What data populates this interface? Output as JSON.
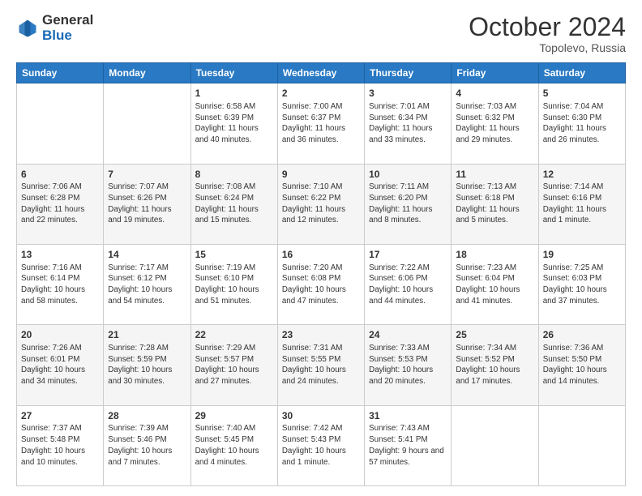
{
  "header": {
    "logo_general": "General",
    "logo_blue": "Blue",
    "month_title": "October 2024",
    "location": "Topolevo, Russia"
  },
  "days_of_week": [
    "Sunday",
    "Monday",
    "Tuesday",
    "Wednesday",
    "Thursday",
    "Friday",
    "Saturday"
  ],
  "weeks": [
    [
      {
        "day": "",
        "sunrise": "",
        "sunset": "",
        "daylight": ""
      },
      {
        "day": "",
        "sunrise": "",
        "sunset": "",
        "daylight": ""
      },
      {
        "day": "1",
        "sunrise": "Sunrise: 6:58 AM",
        "sunset": "Sunset: 6:39 PM",
        "daylight": "Daylight: 11 hours and 40 minutes."
      },
      {
        "day": "2",
        "sunrise": "Sunrise: 7:00 AM",
        "sunset": "Sunset: 6:37 PM",
        "daylight": "Daylight: 11 hours and 36 minutes."
      },
      {
        "day": "3",
        "sunrise": "Sunrise: 7:01 AM",
        "sunset": "Sunset: 6:34 PM",
        "daylight": "Daylight: 11 hours and 33 minutes."
      },
      {
        "day": "4",
        "sunrise": "Sunrise: 7:03 AM",
        "sunset": "Sunset: 6:32 PM",
        "daylight": "Daylight: 11 hours and 29 minutes."
      },
      {
        "day": "5",
        "sunrise": "Sunrise: 7:04 AM",
        "sunset": "Sunset: 6:30 PM",
        "daylight": "Daylight: 11 hours and 26 minutes."
      }
    ],
    [
      {
        "day": "6",
        "sunrise": "Sunrise: 7:06 AM",
        "sunset": "Sunset: 6:28 PM",
        "daylight": "Daylight: 11 hours and 22 minutes."
      },
      {
        "day": "7",
        "sunrise": "Sunrise: 7:07 AM",
        "sunset": "Sunset: 6:26 PM",
        "daylight": "Daylight: 11 hours and 19 minutes."
      },
      {
        "day": "8",
        "sunrise": "Sunrise: 7:08 AM",
        "sunset": "Sunset: 6:24 PM",
        "daylight": "Daylight: 11 hours and 15 minutes."
      },
      {
        "day": "9",
        "sunrise": "Sunrise: 7:10 AM",
        "sunset": "Sunset: 6:22 PM",
        "daylight": "Daylight: 11 hours and 12 minutes."
      },
      {
        "day": "10",
        "sunrise": "Sunrise: 7:11 AM",
        "sunset": "Sunset: 6:20 PM",
        "daylight": "Daylight: 11 hours and 8 minutes."
      },
      {
        "day": "11",
        "sunrise": "Sunrise: 7:13 AM",
        "sunset": "Sunset: 6:18 PM",
        "daylight": "Daylight: 11 hours and 5 minutes."
      },
      {
        "day": "12",
        "sunrise": "Sunrise: 7:14 AM",
        "sunset": "Sunset: 6:16 PM",
        "daylight": "Daylight: 11 hours and 1 minute."
      }
    ],
    [
      {
        "day": "13",
        "sunrise": "Sunrise: 7:16 AM",
        "sunset": "Sunset: 6:14 PM",
        "daylight": "Daylight: 10 hours and 58 minutes."
      },
      {
        "day": "14",
        "sunrise": "Sunrise: 7:17 AM",
        "sunset": "Sunset: 6:12 PM",
        "daylight": "Daylight: 10 hours and 54 minutes."
      },
      {
        "day": "15",
        "sunrise": "Sunrise: 7:19 AM",
        "sunset": "Sunset: 6:10 PM",
        "daylight": "Daylight: 10 hours and 51 minutes."
      },
      {
        "day": "16",
        "sunrise": "Sunrise: 7:20 AM",
        "sunset": "Sunset: 6:08 PM",
        "daylight": "Daylight: 10 hours and 47 minutes."
      },
      {
        "day": "17",
        "sunrise": "Sunrise: 7:22 AM",
        "sunset": "Sunset: 6:06 PM",
        "daylight": "Daylight: 10 hours and 44 minutes."
      },
      {
        "day": "18",
        "sunrise": "Sunrise: 7:23 AM",
        "sunset": "Sunset: 6:04 PM",
        "daylight": "Daylight: 10 hours and 41 minutes."
      },
      {
        "day": "19",
        "sunrise": "Sunrise: 7:25 AM",
        "sunset": "Sunset: 6:03 PM",
        "daylight": "Daylight: 10 hours and 37 minutes."
      }
    ],
    [
      {
        "day": "20",
        "sunrise": "Sunrise: 7:26 AM",
        "sunset": "Sunset: 6:01 PM",
        "daylight": "Daylight: 10 hours and 34 minutes."
      },
      {
        "day": "21",
        "sunrise": "Sunrise: 7:28 AM",
        "sunset": "Sunset: 5:59 PM",
        "daylight": "Daylight: 10 hours and 30 minutes."
      },
      {
        "day": "22",
        "sunrise": "Sunrise: 7:29 AM",
        "sunset": "Sunset: 5:57 PM",
        "daylight": "Daylight: 10 hours and 27 minutes."
      },
      {
        "day": "23",
        "sunrise": "Sunrise: 7:31 AM",
        "sunset": "Sunset: 5:55 PM",
        "daylight": "Daylight: 10 hours and 24 minutes."
      },
      {
        "day": "24",
        "sunrise": "Sunrise: 7:33 AM",
        "sunset": "Sunset: 5:53 PM",
        "daylight": "Daylight: 10 hours and 20 minutes."
      },
      {
        "day": "25",
        "sunrise": "Sunrise: 7:34 AM",
        "sunset": "Sunset: 5:52 PM",
        "daylight": "Daylight: 10 hours and 17 minutes."
      },
      {
        "day": "26",
        "sunrise": "Sunrise: 7:36 AM",
        "sunset": "Sunset: 5:50 PM",
        "daylight": "Daylight: 10 hours and 14 minutes."
      }
    ],
    [
      {
        "day": "27",
        "sunrise": "Sunrise: 7:37 AM",
        "sunset": "Sunset: 5:48 PM",
        "daylight": "Daylight: 10 hours and 10 minutes."
      },
      {
        "day": "28",
        "sunrise": "Sunrise: 7:39 AM",
        "sunset": "Sunset: 5:46 PM",
        "daylight": "Daylight: 10 hours and 7 minutes."
      },
      {
        "day": "29",
        "sunrise": "Sunrise: 7:40 AM",
        "sunset": "Sunset: 5:45 PM",
        "daylight": "Daylight: 10 hours and 4 minutes."
      },
      {
        "day": "30",
        "sunrise": "Sunrise: 7:42 AM",
        "sunset": "Sunset: 5:43 PM",
        "daylight": "Daylight: 10 hours and 1 minute."
      },
      {
        "day": "31",
        "sunrise": "Sunrise: 7:43 AM",
        "sunset": "Sunset: 5:41 PM",
        "daylight": "Daylight: 9 hours and 57 minutes."
      },
      {
        "day": "",
        "sunrise": "",
        "sunset": "",
        "daylight": ""
      },
      {
        "day": "",
        "sunrise": "",
        "sunset": "",
        "daylight": ""
      }
    ]
  ]
}
